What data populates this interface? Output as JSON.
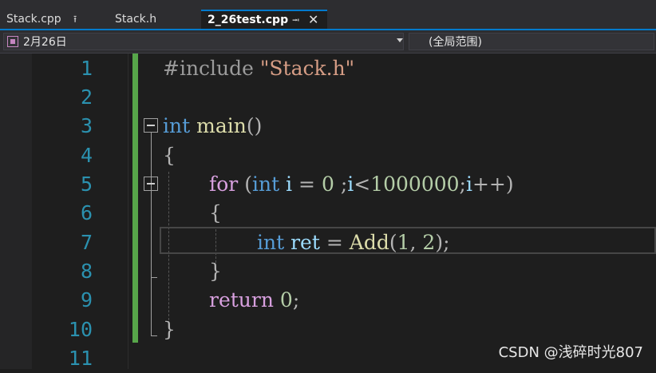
{
  "tabs": [
    {
      "label": "Stack.cpp",
      "pin": "⭱"
    },
    {
      "label": "Stack.h"
    },
    {
      "label": "2_26test.cpp",
      "pin": "⭲",
      "close": "✕",
      "active": true
    }
  ],
  "nav": {
    "left_label": "2月26日",
    "right_label": "(全局范围)"
  },
  "line_numbers": [
    "1",
    "2",
    "3",
    "4",
    "5",
    "6",
    "7",
    "8",
    "9",
    "10",
    "11"
  ],
  "code": {
    "l1": {
      "directive": "#include",
      "path": "\"Stack.h\""
    },
    "l3": {
      "type": "int",
      "name": "main",
      "parens": "()"
    },
    "l4": {
      "brace": "{"
    },
    "l5": {
      "kw_for": "for",
      "open": "(",
      "kw_int": "int",
      "var_i": "i",
      "eq": "=",
      "zero": "0",
      "rest1": ";",
      "i2": "i",
      "lt": "<",
      "limit": "1000000",
      "semi": ";",
      "i3": "i",
      "inc": "++",
      "close": ")"
    },
    "l6": {
      "brace": "{"
    },
    "l7": {
      "type": "int",
      "var": "ret",
      "eq": "=",
      "fn": "Add",
      "open": "(",
      "a": "1",
      "comma": ",",
      "b": "2",
      "close": ")",
      "semi": ";"
    },
    "l8": {
      "brace": "}"
    },
    "l9": {
      "kw": "return",
      "num": "0",
      "semi": ";"
    },
    "l10": {
      "brace": "}"
    }
  },
  "watermark": "CSDN @浅碎时光807"
}
